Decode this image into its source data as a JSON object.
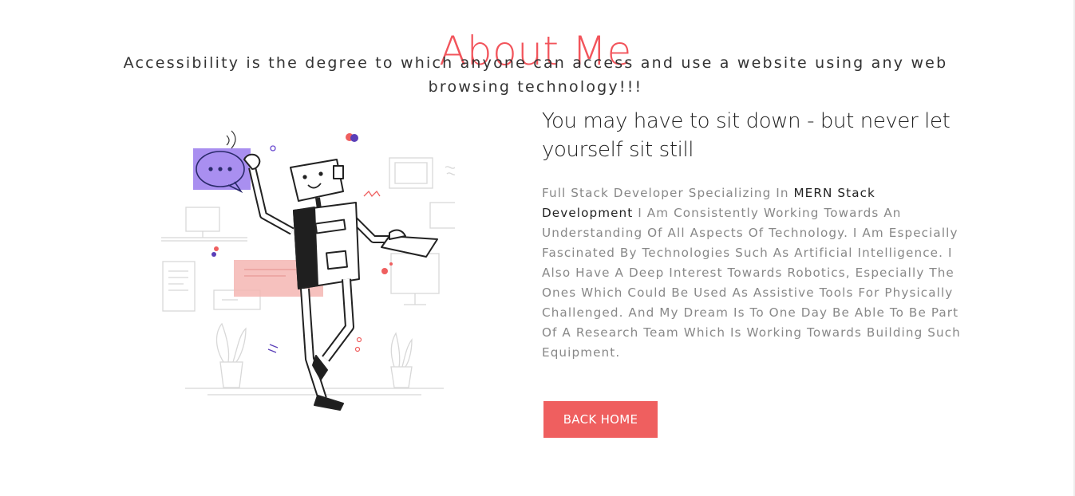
{
  "page": {
    "title": "About Me",
    "subtitle": "Accessibility is the degree to which anyone can access and use a website using any web browsing technology!!!"
  },
  "about": {
    "quote": "You may have to sit down - but never let yourself sit still",
    "bio_intro": "Full Stack Developer Specializing In ",
    "bio_highlight": "MERN Stack Development",
    "bio_rest": " I Am Consistently Working Towards An Understanding Of All Aspects Of Technology. I Am Especially Fascinated By Technologies Such As Artificial Intelligence. I Also Have A Deep Interest Towards Robotics, Especially The Ones Which Could Be Used As Assistive Tools For Physically Challenged. And My Dream Is To One Day Be Able To Be Part Of A Research Team Which Is Working Towards Building Such Equipment."
  },
  "actions": {
    "back_home_label": "BACK HOME"
  },
  "illustration": {
    "icon": "robot-illustration",
    "chat_bubble_icon": "chat-bubble-icon"
  },
  "colors": {
    "accent": "#f2545b",
    "button": "#ef5f5f",
    "purple": "#a98ff0",
    "pink_panel": "#f5b6b3"
  }
}
